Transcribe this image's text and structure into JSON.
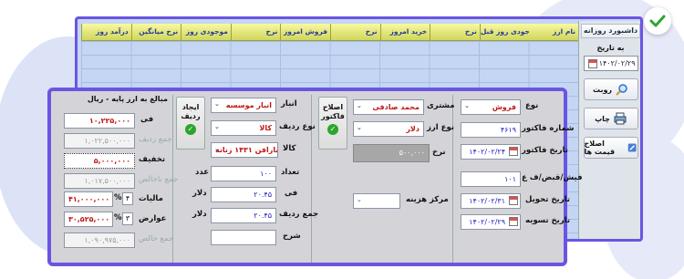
{
  "colors": {
    "accent": "#6a55e2",
    "grid_header": "#e6ec78",
    "check": "#2da52d"
  },
  "grid": {
    "columns": [
      "نام ارز",
      "موجودی روز قبل",
      "نرخ",
      "خرید امروز",
      "نرخ",
      "فروش امروز",
      "نرخ",
      "موجودی روز",
      "نرخ میانگین",
      "درآمد روز"
    ]
  },
  "sidebar": {
    "title": "داشبورد روزانه",
    "date_label": "به تاریخ",
    "date_value": "۱۴۰۲/۰۲/۲۹",
    "btn_refresh": "روبت",
    "btn_print": "چاپ",
    "btn_fix_prices": "اصلاح قیمت ها",
    "icons": [
      "calendar-icon",
      "magnifier-icon",
      "printer-icon",
      "edit-icon"
    ]
  },
  "form": {
    "col1": {
      "type_label": "نوع",
      "type_value": "فروش",
      "invoice_no_label": "شماره فاکتور",
      "invoice_no_value": "۴۶۱۹",
      "invoice_date_label": "تاریخ فاکتور",
      "invoice_date_value": "۱۴۰۲/۰۲/۲۴",
      "receipt_label": "فیش/قبض/ف ع",
      "receipt_value": "۱۰۱",
      "delivery_date_label": "تاریخ تحویل",
      "delivery_date_value": "۱۴۰۲/۰۲/۳۱",
      "settle_date_label": "تاریخ تسویه",
      "settle_date_value": "۱۴۰۲/۰۲/۲۹"
    },
    "col2": {
      "customer_label": "مشتری",
      "customer_value": "محمد صادقی",
      "currency_type_label": "نوع ارز",
      "currency_type_value": "دلار",
      "rate_label": "نرخ",
      "rate_value": "۵۰۰,۰۰۰",
      "cost_center_label": "مرکز هزینه",
      "cost_center_value": "",
      "fix_invoice_btn": "اصلاح فاکتور"
    },
    "col3": {
      "warehouse_label": "انبار",
      "warehouse_value": "انبار موسسه",
      "row_type_label": "نوع ردیف",
      "row_type_value": "کالا",
      "goods_label": "کالا",
      "goods_value": "سارافن ۱۴۳۱ زنانه",
      "qty_label": "تعداد",
      "qty_value": "۱۰۰",
      "fee_label": "فی",
      "fee_value": "۲۰.۴۵",
      "fee_unit": "دلار",
      "row_total_label": "جمع ردیف",
      "row_total_value": "۲۰.۴۵",
      "row_total_unit": "دلار",
      "desc_label": "شرح",
      "desc_value": "",
      "create_row_btn": "ایجاد ردیف"
    },
    "col4": {
      "header": "مبالغ به ارز پایه - ریال",
      "fee_label": "فی",
      "fee_value": "۱۰,۲۲۵,۰۰۰",
      "row_total_label": "جمع ردیف",
      "row_total_value": "۱,۰۲۲,۵۰۰,۰۰۰",
      "discount_label": "تخفیف",
      "discount_value": "۵,۰۰۰,۰۰۰",
      "net_total_label": "جمع ناخالص",
      "net_total_value": "۱,۰۱۷,۵۰۰,۰۰۰",
      "tax_label": "مالیات",
      "tax_pct": "۴",
      "tax_value": "۴۱,۰۰۰,۰۰۰",
      "duty_label": "عوارض",
      "duty_pct": "۳",
      "duty_value": "۳۰,۵۲۵,۰۰۰",
      "grand_total_label": "جمع خالص",
      "grand_total_value": "۱,۰۹۰,۹۷۵,۰۰۰",
      "pct_sign": "%"
    }
  }
}
